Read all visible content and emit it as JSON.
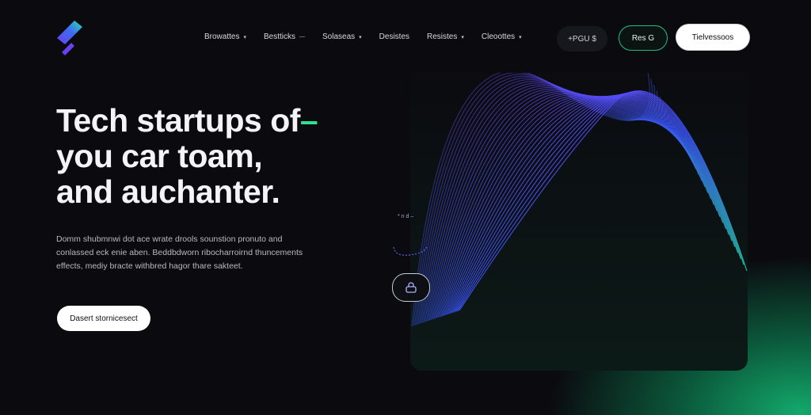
{
  "header": {
    "nav": [
      {
        "label": "Browattes",
        "has_chevron": true
      },
      {
        "label": "Bestticks",
        "has_chevron": true
      },
      {
        "label": "Solaseas",
        "has_chevron": true
      },
      {
        "label": "Desistes",
        "has_chevron": false
      },
      {
        "label": "Resistes",
        "has_chevron": true
      },
      {
        "label": "Cleoottes",
        "has_chevron": true
      }
    ],
    "pill_label": "+PGU $",
    "outline_label": "Res G",
    "white_label": "Tielvessoos"
  },
  "hero": {
    "headline_line1": "Tech startups of",
    "headline_accent": "–",
    "headline_line2": "you car toam,",
    "headline_line3": "and auchanter.",
    "paragraph": "Domm shubmnwi dot ace wrate drools sounstion pronuto and conlassed eck enie aben. Beddbdworn ribocharroirnd thuncements effects, mediy bracte withbred hagor thare sakteet.",
    "cta_label": "Dasert stornicesect"
  },
  "art": {
    "small_label": "* n d –",
    "colors": {
      "purple": "#7b3fe8",
      "blue": "#3a55ff",
      "green": "#26e39a"
    }
  },
  "icons": {
    "chevron": "chevron-down-icon",
    "logo": "brand-logo",
    "lock": "lock-icon"
  }
}
